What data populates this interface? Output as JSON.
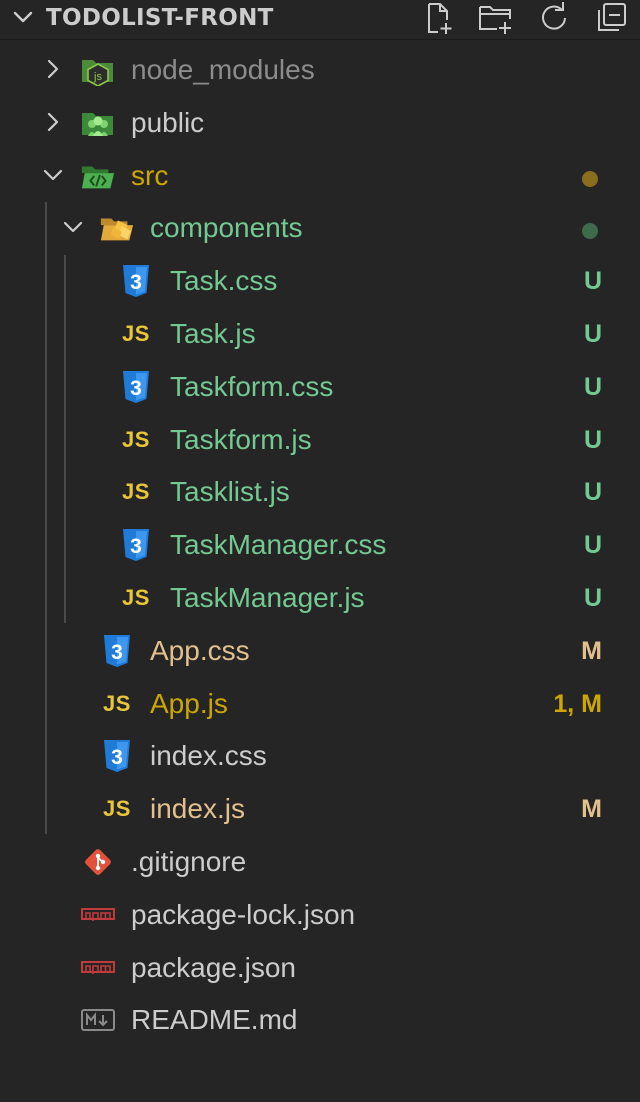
{
  "explorer": {
    "title": "TODOLIST-FRONT",
    "actions": [
      {
        "name": "new-file-icon"
      },
      {
        "name": "new-folder-icon"
      },
      {
        "name": "refresh-icon"
      },
      {
        "name": "collapse-all-icon"
      }
    ]
  },
  "colors": {
    "untracked": "#73c991",
    "modified": "#e2c08d",
    "error_modified": "#cca700",
    "default": "#cccccc",
    "ignored": "#8c8c8c",
    "dot_modified": "#8a6d1f",
    "dot_untracked": "#3d6b4c"
  },
  "tree": [
    {
      "label": "node_modules",
      "icon": "nodejs-folder-icon",
      "depth": 0,
      "kind": "folder",
      "expanded": false,
      "status": "ignored",
      "badge": ""
    },
    {
      "label": "public",
      "icon": "public-folder-icon",
      "depth": 0,
      "kind": "folder",
      "expanded": false,
      "status": "default",
      "badge": ""
    },
    {
      "label": "src",
      "icon": "src-folder-icon",
      "depth": 0,
      "kind": "folder",
      "expanded": true,
      "status": "error_modified",
      "badge": "dot-modified"
    },
    {
      "label": "components",
      "icon": "components-folder-icon",
      "depth": 1,
      "kind": "folder",
      "expanded": true,
      "status": "untracked",
      "badge": "dot-untracked"
    },
    {
      "label": "Task.css",
      "icon": "css-file-icon",
      "depth": 2,
      "kind": "file",
      "status": "untracked",
      "badge": "U"
    },
    {
      "label": "Task.js",
      "icon": "js-file-icon",
      "depth": 2,
      "kind": "file",
      "status": "untracked",
      "badge": "U"
    },
    {
      "label": "Taskform.css",
      "icon": "css-file-icon",
      "depth": 2,
      "kind": "file",
      "status": "untracked",
      "badge": "U"
    },
    {
      "label": "Taskform.js",
      "icon": "js-file-icon",
      "depth": 2,
      "kind": "file",
      "status": "untracked",
      "badge": "U"
    },
    {
      "label": "Tasklist.js",
      "icon": "js-file-icon",
      "depth": 2,
      "kind": "file",
      "status": "untracked",
      "badge": "U"
    },
    {
      "label": "TaskManager.css",
      "icon": "css-file-icon",
      "depth": 2,
      "kind": "file",
      "status": "untracked",
      "badge": "U"
    },
    {
      "label": "TaskManager.js",
      "icon": "js-file-icon",
      "depth": 2,
      "kind": "file",
      "status": "untracked",
      "badge": "U"
    },
    {
      "label": "App.css",
      "icon": "css-file-icon",
      "depth": 1,
      "kind": "file",
      "status": "modified",
      "badge": "M"
    },
    {
      "label": "App.js",
      "icon": "js-file-icon",
      "depth": 1,
      "kind": "file",
      "status": "error_modified",
      "badge": "1, M"
    },
    {
      "label": "index.css",
      "icon": "css-file-icon",
      "depth": 1,
      "kind": "file",
      "status": "default",
      "badge": ""
    },
    {
      "label": "index.js",
      "icon": "js-file-icon",
      "depth": 1,
      "kind": "file",
      "status": "modified",
      "badge": "M"
    },
    {
      "label": ".gitignore",
      "icon": "git-file-icon",
      "depth": 0,
      "kind": "file",
      "status": "default",
      "badge": ""
    },
    {
      "label": "package-lock.json",
      "icon": "npm-file-icon",
      "depth": 0,
      "kind": "file",
      "status": "default",
      "badge": ""
    },
    {
      "label": "package.json",
      "icon": "npm-file-icon",
      "depth": 0,
      "kind": "file",
      "status": "default",
      "badge": ""
    },
    {
      "label": "README.md",
      "icon": "markdown-file-icon",
      "depth": 0,
      "kind": "file",
      "status": "default",
      "badge": ""
    }
  ],
  "icon_text": {
    "js": "JS",
    "css": "3"
  }
}
